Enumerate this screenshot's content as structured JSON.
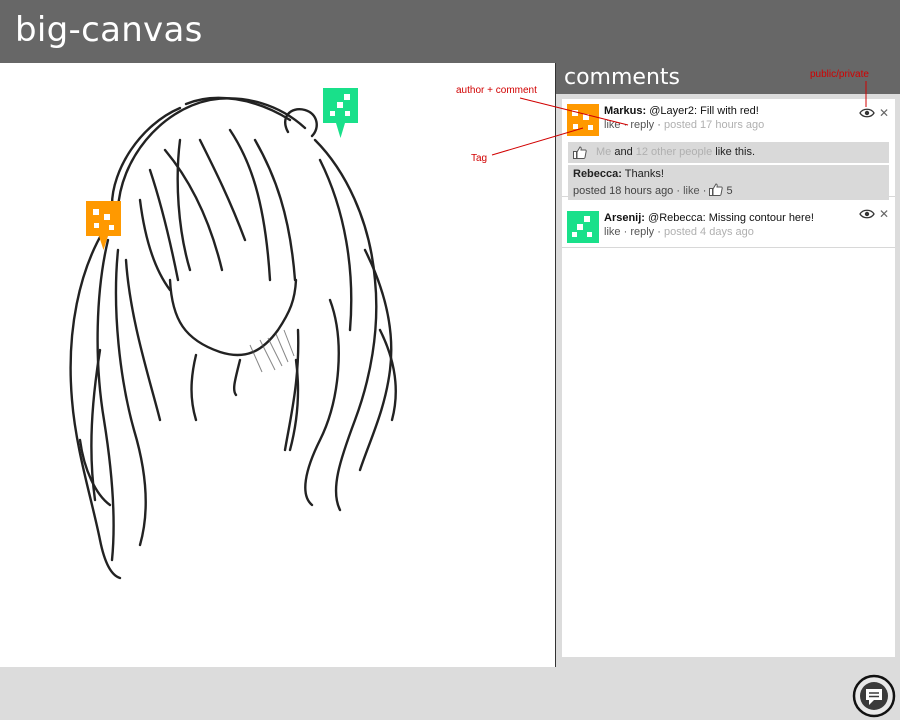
{
  "app": {
    "title": "big-canvas"
  },
  "panel": {
    "title": "comments"
  },
  "comments": [
    {
      "author": "Markus:",
      "text": "@Layer2: Fill with red!",
      "like": "like",
      "reply": "reply",
      "posted": "posted 17 hours ago",
      "avatar_color": "#ff9900",
      "likes": {
        "me": "Me",
        "and": "and",
        "others": "12 other people",
        "suffix": "like this."
      },
      "replies": [
        {
          "author": "Rebecca:",
          "text": "Thanks!",
          "posted": "posted 18 hours ago",
          "like": "like",
          "like_count": "5"
        }
      ]
    },
    {
      "author": "Arsenij:",
      "text": "@Rebecca: Missing contour here!",
      "like": "like",
      "reply": "reply",
      "posted": "posted 4 days ago",
      "avatar_color": "#19e08a"
    }
  ],
  "tags": [
    {
      "color": "#ff9900"
    },
    {
      "color": "#19e08a"
    }
  ],
  "annotations": {
    "author_comment": "author + comment",
    "tag": "Tag",
    "public_private": "public/private"
  },
  "separator": "·"
}
